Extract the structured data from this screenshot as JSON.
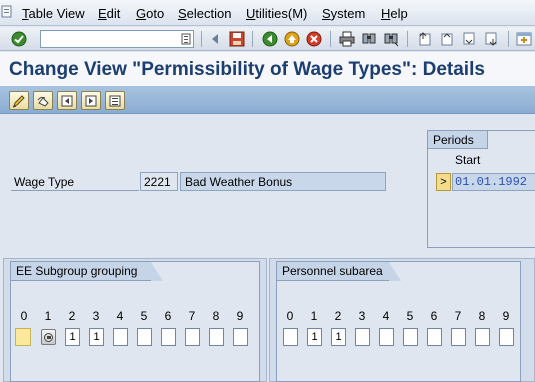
{
  "menu": {
    "items": [
      {
        "id": "table-view",
        "label": "Table View",
        "u": "T",
        "rest": "able View"
      },
      {
        "id": "edit",
        "label": "Edit",
        "u": "E",
        "rest": "dit"
      },
      {
        "id": "goto",
        "label": "Goto",
        "u": "G",
        "rest": "oto"
      },
      {
        "id": "selection",
        "label": "Selection",
        "u": "S",
        "rest": "election"
      },
      {
        "id": "utilities",
        "label": "Utilities(M)",
        "u": "U",
        "rest": "tilities(M)"
      },
      {
        "id": "system",
        "label": "System",
        "u": "S",
        "rest": "ystem"
      },
      {
        "id": "help",
        "label": "Help",
        "u": "H",
        "rest": "elp"
      }
    ]
  },
  "toolbar": {
    "command_field_value": "",
    "icons": [
      "enter-icon",
      "command-history-icon",
      "previous-icon",
      "save-icon",
      "back-icon",
      "exit-icon",
      "cancel-icon",
      "print-icon",
      "find-icon",
      "find-next-icon",
      "first-page-icon",
      "previous-page-icon",
      "next-page-icon",
      "last-page-icon",
      "new-session-icon"
    ]
  },
  "title": "Change View \"Permissibility of Wage Types\": Details",
  "app_toolbar": {
    "icons": [
      "change-display-icon",
      "undo-icon",
      "previous-entry-icon",
      "next-entry-icon",
      "variable-list-icon"
    ]
  },
  "wage_type": {
    "label": "Wage Type",
    "code": "2221",
    "description": "Bad Weather Bonus"
  },
  "periods": {
    "group_title": "Periods",
    "start_label": "Start",
    "start_value": "01.01.1992",
    "button_label": ">"
  },
  "ee_subgroup": {
    "title": "EE Subgroup grouping",
    "columns": [
      "0",
      "1",
      "2",
      "3",
      "4",
      "5",
      "6",
      "7",
      "8",
      "9"
    ],
    "values": [
      "",
      "",
      "1",
      "1",
      "",
      "",
      "",
      "",
      "",
      ""
    ]
  },
  "personnel_subarea": {
    "title": "Personnel subarea",
    "columns": [
      "0",
      "1",
      "2",
      "3",
      "4",
      "5",
      "6",
      "7",
      "8",
      "9"
    ],
    "values": [
      "",
      "1",
      "1",
      "",
      "",
      "",
      "",
      "",
      "",
      ""
    ]
  },
  "colors": {
    "title_text": "#1c3e72",
    "app_toolbar": "#8bacd2",
    "background": "#dfe6f0",
    "date_text": "#2a4fb5",
    "required_field": "#fbe89a"
  }
}
